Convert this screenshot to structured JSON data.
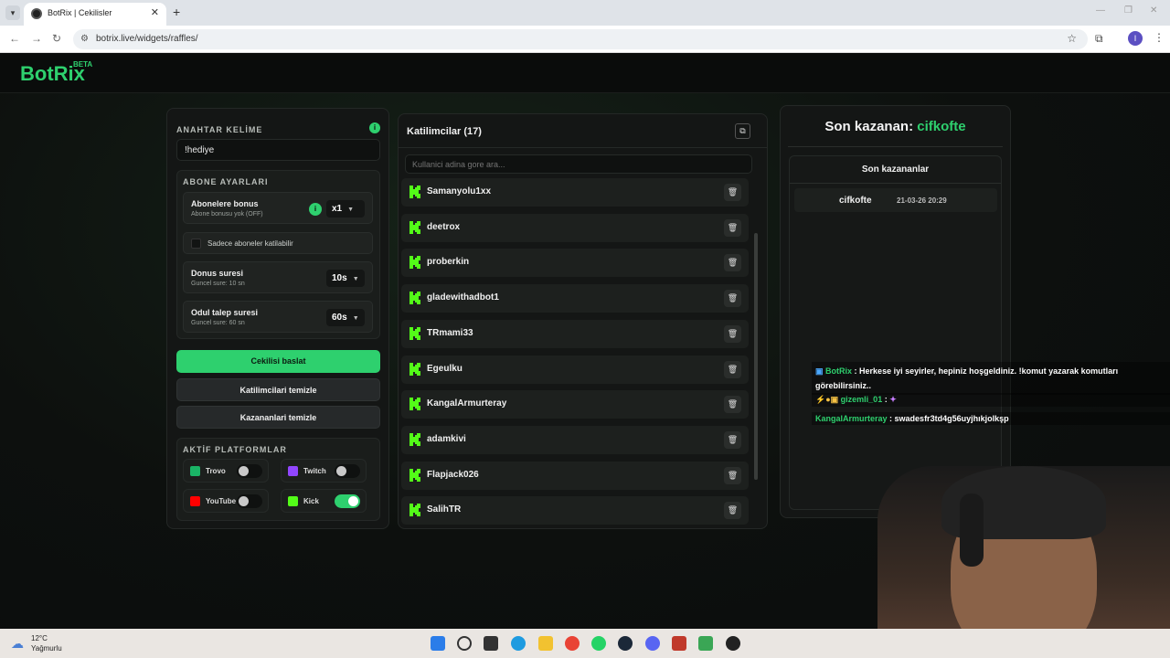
{
  "browser": {
    "tab_title": "BotRix | Cekilisler",
    "url": "botrix.live/widgets/raffles/",
    "profile_initial": "I"
  },
  "app": {
    "logo": "BotRix",
    "beta": "BETA"
  },
  "settings": {
    "keyword_label": "ANAHTAR KELİME",
    "keyword_value": "!hediye",
    "sub_section_label": "ABONE AYARLARI",
    "sub_bonus_title": "Abonelere bonus",
    "sub_bonus_sub": "Abone bonusu yok (OFF)",
    "sub_bonus_value": "x1",
    "sub_only_label": "Sadece aboneler katilabilir",
    "bonus_time_title": "Donus suresi",
    "bonus_time_sub": "Guncel sure: 10 sn",
    "bonus_time_value": "10s",
    "claim_time_title": "Odul talep suresi",
    "claim_time_sub": "Guncel sure: 60 sn",
    "claim_time_value": "60s",
    "start_button": "Cekilisi baslat",
    "clear_participants_button": "Katilimcilari temizle",
    "clear_winners_button": "Kazananlari temizle",
    "platforms_label": "AKTİF PLATFORMLAR",
    "platforms": [
      {
        "name": "Trovo",
        "enabled": false,
        "color": "#1ab466"
      },
      {
        "name": "Twitch",
        "enabled": false,
        "color": "#9146ff"
      },
      {
        "name": "YouTube",
        "enabled": false,
        "color": "#ff0000"
      },
      {
        "name": "Kick",
        "enabled": true,
        "color": "#53fc18"
      }
    ]
  },
  "participants": {
    "title": "Katilimcilar (17)",
    "search_placeholder": "Kullanici adina gore ara...",
    "items": [
      "Samanyolu1xx",
      "deetrox",
      "proberkin",
      "gladewithadbot1",
      "TRmami33",
      "Egeulku",
      "KangalArmurteray",
      "adamkivi",
      "Flapjack026",
      "SalihTR"
    ]
  },
  "winners": {
    "last_winner_label": "Son kazanan:",
    "last_winner_name": "cifkofte",
    "recent_title": "Son kazananlar",
    "recent": [
      {
        "name": "cifkofte",
        "time": "21-03-26 20:29"
      }
    ]
  },
  "chat": [
    {
      "user": "BotRix",
      "text": ": Herkese iyi seyirler, hepiniz hoşgeldiniz. !komut yazarak komutları görebilirsiniz.."
    },
    {
      "user": "gizemli_01",
      "text": ":"
    },
    {
      "user": "KangalArmurteray",
      "text": ": swadesfr3td4g56uyjhıkjolkşp"
    }
  ],
  "taskbar": {
    "temp": "12°C",
    "weather": "Yağmurlu"
  },
  "colors": {
    "accent": "#2ed06e",
    "kick": "#53fc18"
  }
}
